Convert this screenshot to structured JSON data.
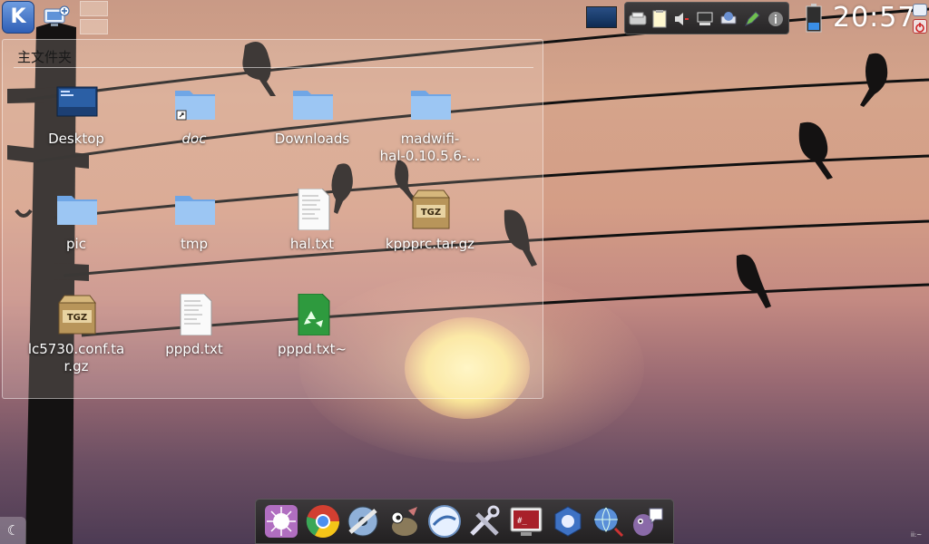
{
  "panel": {
    "kmenu_glyph": "K",
    "clock": "20:57",
    "tray_icons": [
      "clipboard-icon",
      "notes-icon",
      "volume-icon",
      "network-icon",
      "printer-icon",
      "bluetooth-icon",
      "pen-icon",
      "info-icon"
    ]
  },
  "folder_view": {
    "title": "主文件夹",
    "items": [
      {
        "label": "Desktop",
        "icon": "desktop-icon"
      },
      {
        "label": "doc",
        "icon": "folder-link-icon"
      },
      {
        "label": "Downloads",
        "icon": "folder-icon"
      },
      {
        "label": "madwifi-hal-0.10.5.6-…",
        "line1": "madwifi-",
        "line2": "hal-0.10.5.6-…",
        "icon": "folder-icon"
      },
      {
        "label": "pic",
        "icon": "folder-icon"
      },
      {
        "label": "tmp",
        "icon": "folder-icon"
      },
      {
        "label": "hal.txt",
        "icon": "text-file-icon"
      },
      {
        "label": "kppprc.tar.gz",
        "icon": "archive-icon"
      },
      {
        "label": "lc5730.conf.tar.gz",
        "line1": "lc5730.conf.ta",
        "line2": "r.gz",
        "icon": "archive-icon"
      },
      {
        "label": "pppd.txt",
        "icon": "text-file-icon"
      },
      {
        "label": "pppd.txt~",
        "icon": "recycle-file-icon"
      }
    ]
  },
  "archive_badge": "TGZ",
  "terminal_glyph": "#_",
  "dock": {
    "icons": [
      "plasma-icon",
      "chrome-icon",
      "media-icon",
      "gimp-icon",
      "browser-icon",
      "tools-icon",
      "terminal-icon",
      "network-manager-icon",
      "globe-icon",
      "pidgin-icon"
    ]
  },
  "bottom_left_glyph": "☾",
  "corner_text": "ii:~"
}
